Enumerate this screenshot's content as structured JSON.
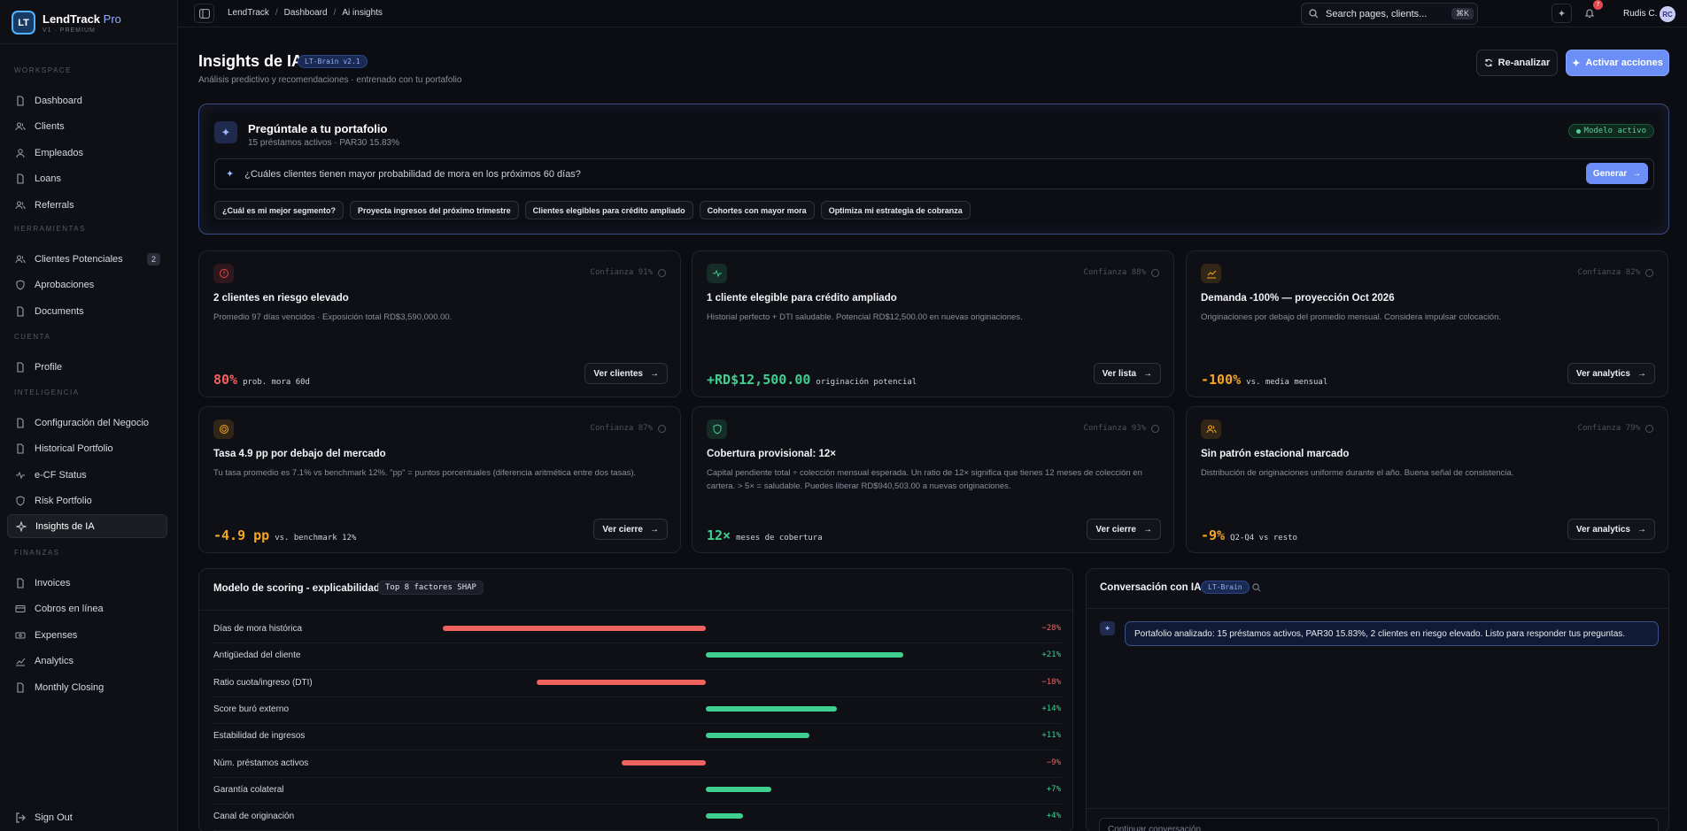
{
  "brand": {
    "name": "LendTrack",
    "tier": "Pro",
    "sub": "V1 · PREMIUM",
    "logo": "LT"
  },
  "sidebar": {
    "sections": [
      {
        "label": "WORKSPACE",
        "items": [
          {
            "label": "Dashboard",
            "icon": "file-icon"
          },
          {
            "label": "Clients",
            "icon": "users-icon"
          },
          {
            "label": "Empleados",
            "icon": "user-icon"
          },
          {
            "label": "Loans",
            "icon": "file-icon"
          },
          {
            "label": "Referrals",
            "icon": "users-icon"
          }
        ]
      },
      {
        "label": "HERRAMIENTAS",
        "items": [
          {
            "label": "Clientes Potenciales",
            "icon": "users-icon",
            "badge": "2"
          },
          {
            "label": "Aprobaciones",
            "icon": "shield-icon"
          },
          {
            "label": "Documents",
            "icon": "file-icon"
          }
        ]
      },
      {
        "label": "CUENTA",
        "items": [
          {
            "label": "Profile",
            "icon": "file-icon"
          }
        ]
      },
      {
        "label": "INTELIGENCIA",
        "items": [
          {
            "label": "Configuración del Negocio",
            "icon": "file-icon"
          },
          {
            "label": "Historical Portfolio",
            "icon": "file-icon"
          },
          {
            "label": "e-CF Status",
            "icon": "wave-icon"
          },
          {
            "label": "Risk Portfolio",
            "icon": "shield-icon"
          },
          {
            "label": "Insights de IA",
            "icon": "sparkle-icon",
            "active": true
          }
        ]
      },
      {
        "label": "FINANZAS",
        "items": [
          {
            "label": "Invoices",
            "icon": "file-icon"
          },
          {
            "label": "Cobros en línea",
            "icon": "card-icon"
          },
          {
            "label": "Expenses",
            "icon": "cash-icon"
          },
          {
            "label": "Analytics",
            "icon": "chart-icon"
          },
          {
            "label": "Monthly Closing",
            "icon": "file-icon"
          }
        ]
      }
    ],
    "signout": "Sign Out"
  },
  "topbar": {
    "crumbs": [
      "LendTrack",
      "Dashboard",
      "Ai insights"
    ],
    "search_placeholder": "Search pages, clients...",
    "shortcut": "⌘K",
    "notif_count": "7",
    "user": "Rudis C.",
    "initials": "RC"
  },
  "page": {
    "title": "Insights de IA",
    "version": "LT-Brain v2.1",
    "subtitle": "Análisis predictivo y recomendaciones · entrenado con tu portafolio",
    "reanalyze": "Re-analizar",
    "activate": "Activar acciones"
  },
  "ask": {
    "title": "Pregúntale a tu portafolio",
    "sub": "15 préstamos activos · PAR30 15.83%",
    "model": "Modelo activo",
    "query": "¿Cuáles clientes tienen mayor probabilidad de mora en los próximos 60 días?",
    "generate": "Generar",
    "chips": [
      "¿Cuál es mi mejor segmento?",
      "Proyecta ingresos del próximo trimestre",
      "Clientes elegibles para crédito ampliado",
      "Cohortes con mayor mora",
      "Optimiza mi estrategia de cobranza"
    ]
  },
  "cards": [
    {
      "icon": "alert-icon",
      "tone": "#e5484d",
      "confidence": "Confianza 91%",
      "title": "2 clientes en riesgo elevado",
      "desc": "Promedio 97 días vencidos · Exposición total RD$3,590,000.00.",
      "value": "80%",
      "unit": "prob. mora 60d",
      "action": "Ver clientes"
    },
    {
      "icon": "pulse-icon",
      "tone": "#3fcf8e",
      "confidence": "Confianza 88%",
      "title": "1 cliente elegible para crédito ampliado",
      "desc": "Historial perfecto + DTI saludable. Potencial RD$12,500.00 en nuevas originaciones.",
      "value": "+RD$12,500.00",
      "unit": "originación potencial",
      "action": "Ver lista"
    },
    {
      "icon": "trend-icon",
      "tone": "#f5a524",
      "confidence": "Confianza 82%",
      "title": "Demanda -100% — proyección Oct 2026",
      "desc": "Originaciones por debajo del promedio mensual. Considera impulsar colocación.",
      "value": "-100%",
      "unit": "vs. media mensual",
      "action": "Ver analytics"
    },
    {
      "icon": "target-icon",
      "tone": "#f5a524",
      "confidence": "Confianza 87%",
      "title": "Tasa 4.9 pp por debajo del mercado",
      "desc": "Tu tasa promedio es 7.1% vs benchmark 12%. \"pp\" = puntos porcentuales (diferencia aritmética entre dos tasas).",
      "value": "-4.9 pp",
      "unit": "vs. benchmark 12%",
      "action": "Ver cierre"
    },
    {
      "icon": "shield-icon",
      "tone": "#3fcf8e",
      "confidence": "Confianza 93%",
      "title": "Cobertura provisional: 12×",
      "desc": "Capital pendiente total ÷ colección mensual esperada. Un ratio de 12× significa que tienes 12 meses de colección en cartera. > 5× = saludable. Puedes liberar RD$940,503.00 a nuevas originaciones.",
      "value": "12×",
      "unit": "meses de cobertura",
      "action": "Ver cierre"
    },
    {
      "icon": "users-icon",
      "tone": "#f5a524",
      "confidence": "Confianza 79%",
      "title": "Sin patrón estacional marcado",
      "desc": "Distribución de originaciones uniforme durante el año. Buena señal de consistencia.",
      "value": "-9%",
      "unit": "Q2-Q4 vs resto",
      "action": "Ver analytics"
    }
  ],
  "shap": {
    "title": "Modelo de scoring - explicabilidad",
    "badge": "Top 8 factores SHAP",
    "factors": [
      {
        "label": "Días de mora histórica",
        "value": -28,
        "text": "−28%"
      },
      {
        "label": "Antigüedad del cliente",
        "value": 21,
        "text": "+21%"
      },
      {
        "label": "Ratio cuota/ingreso (DTI)",
        "value": -18,
        "text": "−18%"
      },
      {
        "label": "Score buró externo",
        "value": 14,
        "text": "+14%"
      },
      {
        "label": "Estabilidad de ingresos",
        "value": 11,
        "text": "+11%"
      },
      {
        "label": "Núm. préstamos activos",
        "value": -9,
        "text": "−9%"
      },
      {
        "label": "Garantía colateral",
        "value": 7,
        "text": "+7%"
      },
      {
        "label": "Canal de originación",
        "value": 4,
        "text": "+4%"
      }
    ]
  },
  "chat": {
    "title": "Conversación con IA",
    "badge": "LT-Brain",
    "message": "Portafolio analizado: 15 préstamos activos, PAR30 15.83%, 2 clientes en riesgo elevado. Listo para responder tus preguntas.",
    "placeholder": "Continuar conversación..."
  },
  "colors": {
    "accent": "#6c8ff7",
    "negative": "#f0625e",
    "positive": "#3fcf8e",
    "warning": "#f5a524"
  }
}
